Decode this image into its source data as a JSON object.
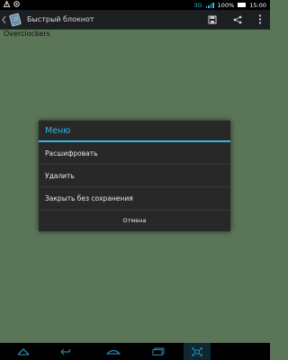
{
  "status_bar": {
    "network": "3G",
    "battery_percent": "100%",
    "battery_level": 1.0,
    "time": "15:00",
    "left_icons": [
      "warning-icon",
      "settings-circle-icon"
    ]
  },
  "action_bar": {
    "title": "Быстрый блокнот",
    "icons": [
      "app-notepad-icon",
      "save-icon",
      "share-icon",
      "overflow-menu-icon"
    ]
  },
  "note": {
    "text": "Overclockers"
  },
  "dialog": {
    "title": "Меню",
    "items": [
      {
        "label": "Расшифровать"
      },
      {
        "label": "Удалить"
      },
      {
        "label": "Закрыть без сохранения"
      }
    ],
    "cancel_label": "Отмена"
  },
  "nav_bar": {
    "icons": [
      "home-arrow-icon",
      "back-icon",
      "home-icon",
      "recents-icon",
      "screenshot-icon"
    ]
  },
  "colors": {
    "accent": "#33b5e5",
    "background": "#5b7559",
    "dialog": "#282828"
  }
}
